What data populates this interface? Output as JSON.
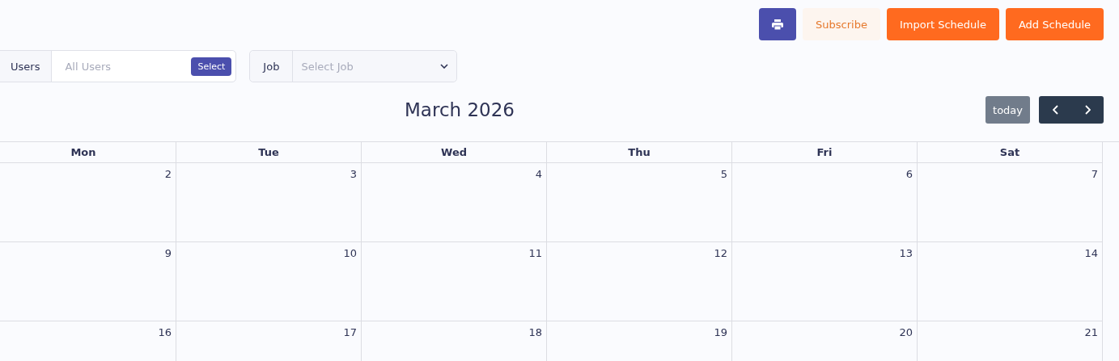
{
  "toolbar": {
    "buttons": [
      {
        "kind": "print"
      },
      {
        "kind": "soft",
        "label": "Subscribe"
      },
      {
        "kind": "primary",
        "label": "Import Schedule"
      },
      {
        "kind": "primary",
        "label": "Add Schedule"
      }
    ]
  },
  "filters": {
    "users": {
      "label": "Users",
      "placeholder": "All Users",
      "button": "Select"
    },
    "job": {
      "label": "Job",
      "placeholder": "Select Job"
    }
  },
  "calendar": {
    "title": "March 2026",
    "today": "today",
    "weekdays": [
      "Mon",
      "Tue",
      "Wed",
      "Thu",
      "Fri",
      "Sat"
    ],
    "weeks": [
      [
        "2",
        "3",
        "4",
        "5",
        "6",
        "7"
      ],
      [
        "9",
        "10",
        "11",
        "12",
        "13",
        "14"
      ],
      [
        "16",
        "17",
        "18",
        "19",
        "20",
        "21"
      ]
    ]
  }
}
